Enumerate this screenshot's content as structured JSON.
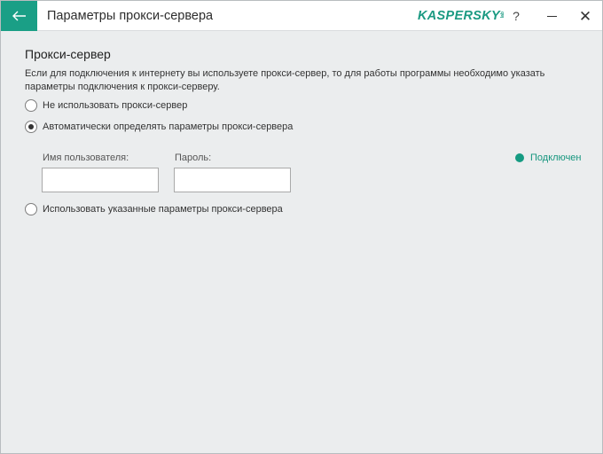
{
  "window": {
    "title": "Параметры прокси-сервера",
    "brand": "KASPERSKY",
    "brand_suffix": "lab",
    "help_label": "?",
    "close_label": "✕"
  },
  "colors": {
    "accent": "#1a9f86",
    "status_connected": "#159b82"
  },
  "proxy": {
    "section_title": "Прокси-сервер",
    "description": "Если для подключения к интернету вы используете прокси-сервер, то для работы программы необходимо указать параметры подключения к прокси-серверу.",
    "options": [
      {
        "label": "Не использовать прокси-сервер",
        "checked": false
      },
      {
        "label": "Автоматически определять параметры прокси-сервера",
        "checked": true
      },
      {
        "label": "Использовать указанные параметры прокси-сервера",
        "checked": false
      }
    ],
    "username_label": "Имя пользователя:",
    "username_value": "",
    "password_label": "Пароль:",
    "password_value": "",
    "status_text": "Подключен"
  },
  "icons": {
    "back": "arrow-left-icon",
    "help": "question-icon",
    "minimize": "minimize-icon",
    "close": "close-icon",
    "status": "status-dot-icon"
  }
}
